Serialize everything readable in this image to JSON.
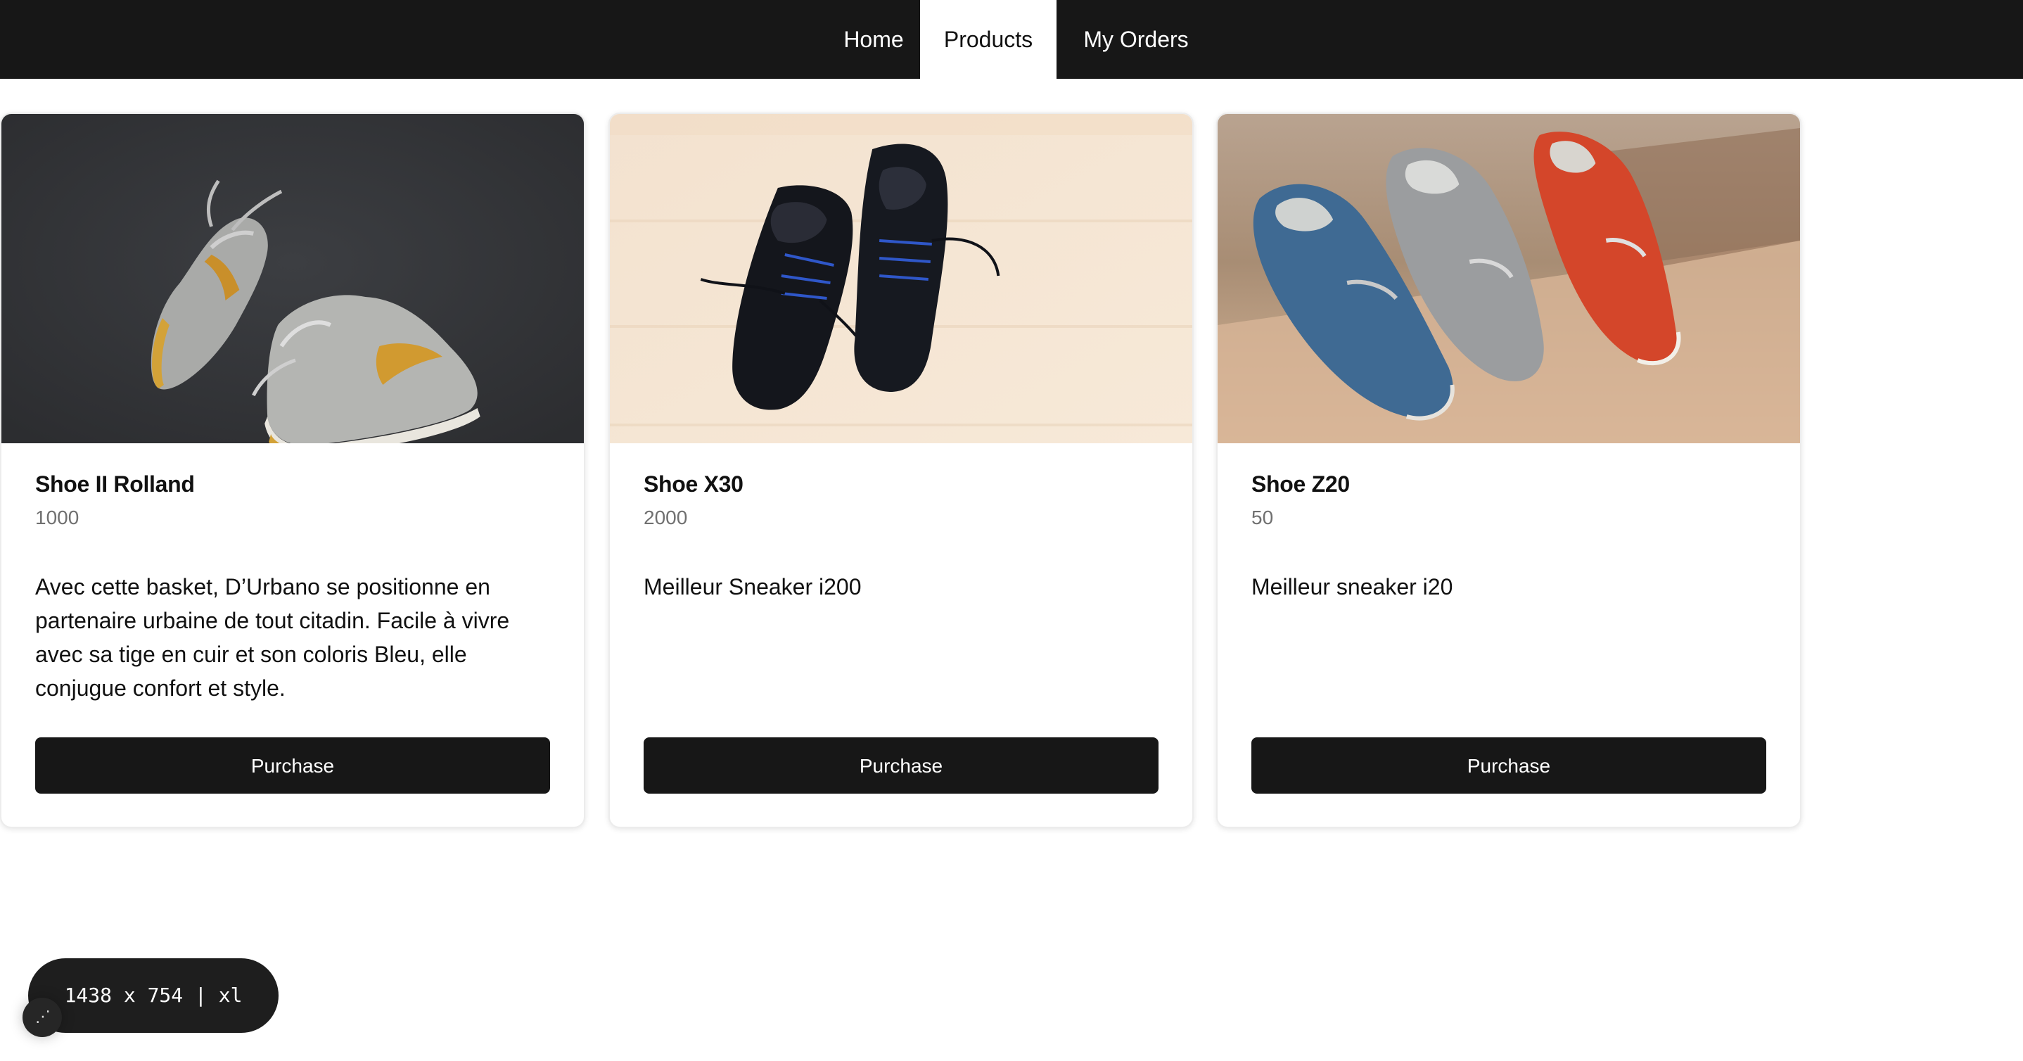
{
  "nav": {
    "items": [
      {
        "label": "Home",
        "active": false
      },
      {
        "label": "Products",
        "active": true
      },
      {
        "label": "My Orders",
        "active": false
      }
    ]
  },
  "products": [
    {
      "title": "Shoe II Rolland",
      "price": "1000",
      "description": "Avec cette basket, D’Urbano se positionne en partenaire urbaine de tout citadin. Facile à vivre avec sa tige en cuir et son coloris Bleu, elle conjugue confort et style.",
      "button_label": "Purchase",
      "image_icon": "grey-high-top-sneakers-image"
    },
    {
      "title": "Shoe X30",
      "price": "2000",
      "description": "Meilleur Sneaker i200",
      "button_label": "Purchase",
      "image_icon": "black-oxford-shoes-image"
    },
    {
      "title": "Shoe Z20",
      "price": "50",
      "description": "Meilleur sneaker i20",
      "button_label": "Purchase",
      "image_icon": "colored-loafers-image"
    }
  ],
  "debug": {
    "breakpoint_label": "1438 x 754 | xl"
  },
  "colors": {
    "nav_background": "#171717",
    "button_background": "#171717",
    "price_text": "#707070"
  }
}
